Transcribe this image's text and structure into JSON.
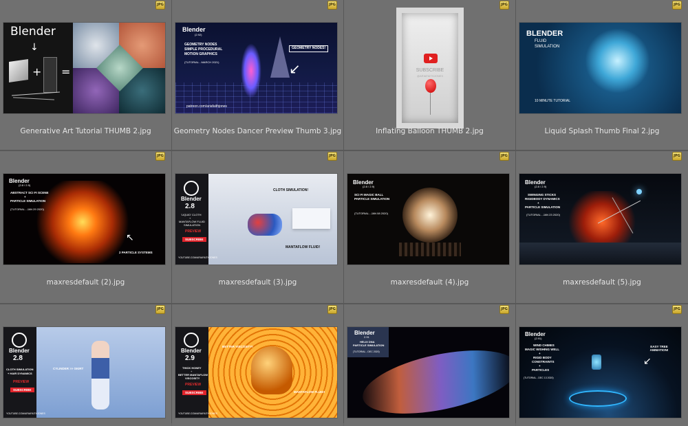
{
  "badge_text": "JPG",
  "items": [
    {
      "filename": "Generative Art Tutorial THUMB 2.jpg",
      "thumb": {
        "logo": "Blender"
      }
    },
    {
      "filename": "Geometry Nodes Dancer Preview Thumb 3.jpg",
      "thumb": {
        "logo": "Blender",
        "version": "(2.92)",
        "lines": [
          "GEOMETRY NODES",
          "SIMPLE PROCEDURAL",
          "MOTION GRAPHICS"
        ],
        "date": "(TUTORIAL - MARCH 2021)",
        "callout": "GEOMETRY NODES!",
        "footer": "patreon.com/ariafaithjones"
      }
    },
    {
      "filename": "Inflating Balloon THUMB 2.jpg",
      "thumb": {
        "subscribe": "SUBSCRIBE",
        "handle": "@ARIAFAITHJONES"
      }
    },
    {
      "filename": "Liquid Splash Thumb Final 2.jpg",
      "thumb": {
        "logo": "BLENDER",
        "lines": [
          "FLUID",
          "SIMULATION"
        ],
        "subtitle": "10 MINUTE TUTORIAL"
      }
    },
    {
      "filename": "maxresdefault (2).jpg",
      "thumb": {
        "logo": "Blender",
        "version": "(2.8 / 2.9)",
        "lines": [
          "ABSTRACT SCI FI SCENE",
          "+",
          "PARTICLE SIMULATION"
        ],
        "date": "(TUTORIAL - JAN 29 2020)",
        "callout": "2 PARTICLE SYSTEMS"
      }
    },
    {
      "filename": "maxresdefault (3).jpg",
      "thumb": {
        "logo": "Blender",
        "version": "2.8",
        "lines": [
          "'LIQUID' CLOTH",
          "+",
          "MANTAFLOW FLUID",
          "SIMULATION"
        ],
        "preview": "PREVIEW",
        "subscribe": "SUBSCRIBE",
        "callouts": [
          "CLOTH SIMULATION!",
          "MANTAFLOW FLUID!"
        ],
        "footer": "YOUTUBE.COM/ARIAFAITHJONES"
      }
    },
    {
      "filename": "maxresdefault (4).jpg",
      "thumb": {
        "logo": "Blender",
        "version": "(2.8 / 2.9)",
        "lines": [
          "SCI FI MAGIC BALL",
          "PARTICLE SIMULATION"
        ],
        "date": "(TUTORIAL - JAN 08 2020)"
      }
    },
    {
      "filename": "maxresdefault (5).jpg",
      "thumb": {
        "logo": "Blender",
        "version": "(2.8 / 2.9)",
        "lines": [
          "SWINGING STICKS",
          "RIGIDBODY DYNAMICS",
          "+",
          "PARTICLE SIMULATION"
        ],
        "date": "(TUTORIAL - JAN 23 2020)"
      }
    },
    {
      "filename": "",
      "thumb": {
        "logo": "Blender",
        "version": "2.8",
        "lines": [
          "CLOTH SIMULATION",
          "+ HAIR DYNAMICS"
        ],
        "preview": "PREVIEW",
        "subscribe": "SUBSCRIBE",
        "callout": "CYLINDER >> SKIRT",
        "footer": "YOUTUBE.COM/ARIAFAITHJONES"
      }
    },
    {
      "filename": "",
      "thumb": {
        "logo": "Blender",
        "version": "2.9",
        "lines": [
          "THICK HONEY",
          "+",
          "BETTER MANTAFLOW",
          "VISCOSITY"
        ],
        "preview": "PREVIEW",
        "subscribe": "SUBSCRIBE",
        "callouts": [
          "BETTER VISCOSITY!",
          "MANTAFLOW FLUID!"
        ],
        "footer": "YOUTUBE.COM/ARIAFAITHJONES"
      }
    },
    {
      "filename": "",
      "thumb": {
        "logo": "Blender",
        "version": "2.91",
        "lines": [
          "HELIX DNA",
          "PARTICLE SIMULATION"
        ],
        "date": "(TUTORIAL - DEC 2020)"
      }
    },
    {
      "filename": "",
      "thumb": {
        "logo": "Blender",
        "version": "(2.91)",
        "lines": [
          "WIND CHIMES",
          "MAGIC WISHING WELL",
          "+",
          "RIGID BODY",
          "CONSTRAINTS",
          "+",
          "PARTICLES"
        ],
        "date": "(TUTORIAL - DEC 13 2020)",
        "callout": "EASY TREE ANIMATION!"
      }
    }
  ]
}
